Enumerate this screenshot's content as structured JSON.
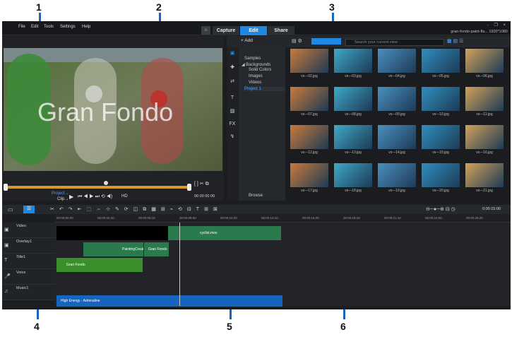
{
  "menu": [
    "File",
    "Edit",
    "Tools",
    "Settings",
    "Help"
  ],
  "tabs": {
    "home_icon": "home-icon",
    "capture": "Capture",
    "edit": "Edit",
    "share": "Share"
  },
  "project_name": "gran-fondo-paint-fla... 1920*1080",
  "window_controls": "- ❐ ×",
  "preview": {
    "title_text": "Gran Fondo",
    "project_label": "Project→",
    "clip_label": "Clip→",
    "hd_label": "HD",
    "timecode": "00 00 00 00"
  },
  "library": {
    "add_label": "+ Add",
    "search_placeholder": "Search your current view",
    "tree": [
      "Samples",
      "◢ Backgrounds",
      "Solid Colors",
      "Images",
      "Videos",
      "Project 1"
    ],
    "browse_label": "Browse",
    "thumbs": [
      "vs---02.jpg",
      "vs---03.jpg",
      "vs---04.jpg",
      "vs---05.jpg",
      "vs---06.jpg",
      "vs---07.jpg",
      "vs---08.jpg",
      "vs---09.jpg",
      "vs---10.jpg",
      "vs---11.jpg",
      "vs---12.jpg",
      "vs---13.jpg",
      "vs---14.jpg",
      "vs---15.jpg",
      "vs---16.jpg",
      "vs---17.jpg",
      "vs---18.jpg",
      "vs---19.jpg",
      "vs---20.jpg",
      "vs---21.jpg"
    ]
  },
  "timeline": {
    "timecode": "0:00:15:00",
    "ruler": [
      "00:00:00:00",
      "00:00:02:20",
      "00:00:05:10",
      "00:00:08:00",
      "00:00:10:20",
      "00:00:13:10",
      "00:00:16:00",
      "00:00:18:20",
      "00:00:21:10",
      "00:00:24:00",
      "00:00:26:20"
    ],
    "tracks": [
      "Video",
      "Overlay1",
      "Title1",
      "Voice",
      "Music1"
    ],
    "clips": {
      "video": "cyclist.mov",
      "overlay": "PaintingCreator\"1",
      "overlay2": "Gran Fondo",
      "title": "Gran Fondo",
      "music": "High Energy - Adrenaline"
    },
    "time_label": "0:00:15:00"
  },
  "annotations": [
    "1",
    "2",
    "3",
    "4",
    "5",
    "6"
  ],
  "colors": {
    "accent": "#1e88e5",
    "arrow": "#1565c0",
    "music": "#1565c0",
    "title": "#3a8f2a",
    "video": "#2a7a4e"
  }
}
